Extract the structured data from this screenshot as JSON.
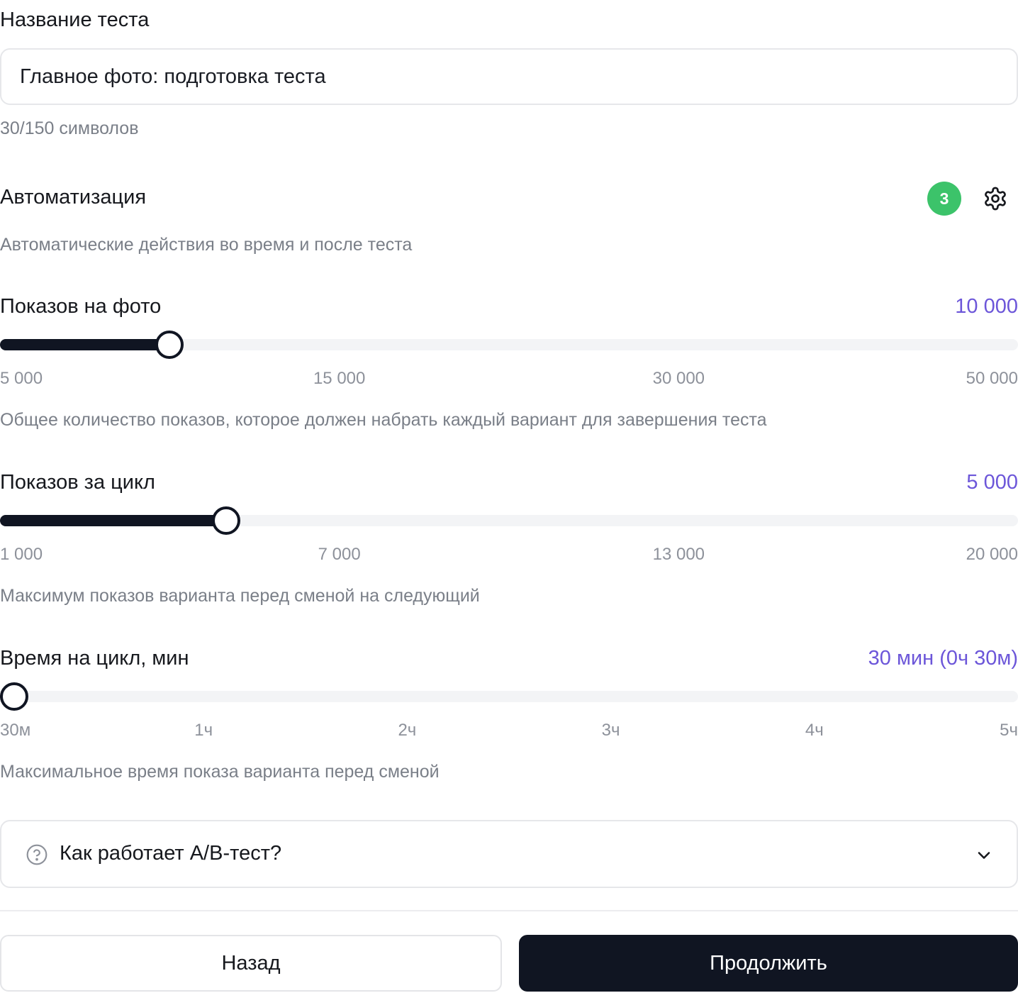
{
  "test_name": {
    "label": "Название теста",
    "value": "Главное фото: подготовка теста",
    "char_count": "30/150 символов"
  },
  "automation": {
    "label": "Автоматизация",
    "badge_count": "3",
    "badge_color": "#3cc36a",
    "settings_icon": "gear-icon",
    "description": "Автоматические действия во время и после теста"
  },
  "sliders": [
    {
      "title": "Показов на фото",
      "value_text": "10 000",
      "value": 10000,
      "ticks": [
        {
          "label": "5 000",
          "value": 5000
        },
        {
          "label": "15 000",
          "value": 15000
        },
        {
          "label": "30 000",
          "value": 30000
        },
        {
          "label": "50 000",
          "value": 50000
        }
      ],
      "description": "Общее количество показов, которое должен набрать каждый вариант для завершения теста"
    },
    {
      "title": "Показов за цикл",
      "value_text": "5 000",
      "value": 5000,
      "ticks": [
        {
          "label": "1 000",
          "value": 1000
        },
        {
          "label": "7 000",
          "value": 7000
        },
        {
          "label": "13 000",
          "value": 13000
        },
        {
          "label": "20 000",
          "value": 20000
        }
      ],
      "description": "Максимум показов варианта перед сменой на следующий"
    },
    {
      "title": "Время на цикл, мин",
      "value_text": "30 мин (0ч 30м)",
      "value": 30,
      "ticks": [
        {
          "label": "30м",
          "value": 30
        },
        {
          "label": "1ч",
          "value": 60
        },
        {
          "label": "2ч",
          "value": 120
        },
        {
          "label": "3ч",
          "value": 180
        },
        {
          "label": "4ч",
          "value": 240
        },
        {
          "label": "5ч",
          "value": 300
        }
      ],
      "description": "Максимальное время показа варианта перед сменой"
    }
  ],
  "faq": {
    "label": "Как работает A/B-тест?",
    "icon": "question-circle-icon",
    "chevron": "chevron-down-icon"
  },
  "footer": {
    "back_label": "Назад",
    "continue_label": "Продолжить"
  },
  "colors": {
    "accent": "#6c56d9",
    "primary_dark": "#101522",
    "badge_green": "#3cc36a"
  }
}
